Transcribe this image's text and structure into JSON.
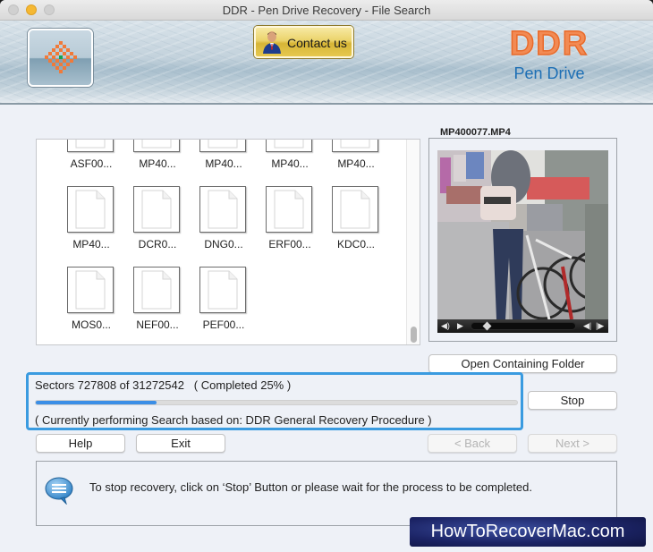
{
  "window": {
    "title": "DDR - Pen Drive Recovery - File Search"
  },
  "header": {
    "contact_label": "Contact us",
    "brand_title": "DDR",
    "brand_subtitle": "Pen Drive",
    "colors": {
      "brand_orange": "#f28a53",
      "brand_blue": "#1d6fb5",
      "contact_gold": "#e6c84e"
    }
  },
  "files": {
    "items": [
      {
        "name": "ASF00...",
        "icon": "file-icon"
      },
      {
        "name": "MP40...",
        "icon": "file-icon"
      },
      {
        "name": "MP40...",
        "icon": "file-icon"
      },
      {
        "name": "MP40...",
        "icon": "file-icon"
      },
      {
        "name": "MP40...",
        "icon": "file-icon"
      },
      {
        "name": "MP40...",
        "icon": "file-icon"
      },
      {
        "name": "DCR0...",
        "icon": "file-icon"
      },
      {
        "name": "DNG0...",
        "icon": "file-icon"
      },
      {
        "name": "ERF00...",
        "icon": "file-icon"
      },
      {
        "name": "KDC0...",
        "icon": "file-icon"
      },
      {
        "name": "MOS0...",
        "icon": "file-icon"
      },
      {
        "name": "NEF00...",
        "icon": "file-icon"
      },
      {
        "name": "PEF00...",
        "icon": "file-icon"
      }
    ]
  },
  "preview": {
    "filename": "MP400077.MP4",
    "seek_position": 0.1,
    "open_folder_label": "Open Containing Folder"
  },
  "progress": {
    "sectors_text": "Sectors 727808 of 31272542   ( Completed 25% )",
    "sectors_done": 727808,
    "sectors_total": 31272542,
    "percent": 25,
    "status_text": "( Currently performing Search based on: DDR General Recovery Procedure )",
    "bar_color": "#3b8ee6"
  },
  "buttons": {
    "stop": "Stop",
    "help": "Help",
    "exit": "Exit",
    "back": "< Back",
    "next": "Next >"
  },
  "message": {
    "text": "To stop recovery, click on ‘Stop’ Button or please wait for the process to be completed."
  },
  "watermark": "HowToRecoverMac.com"
}
